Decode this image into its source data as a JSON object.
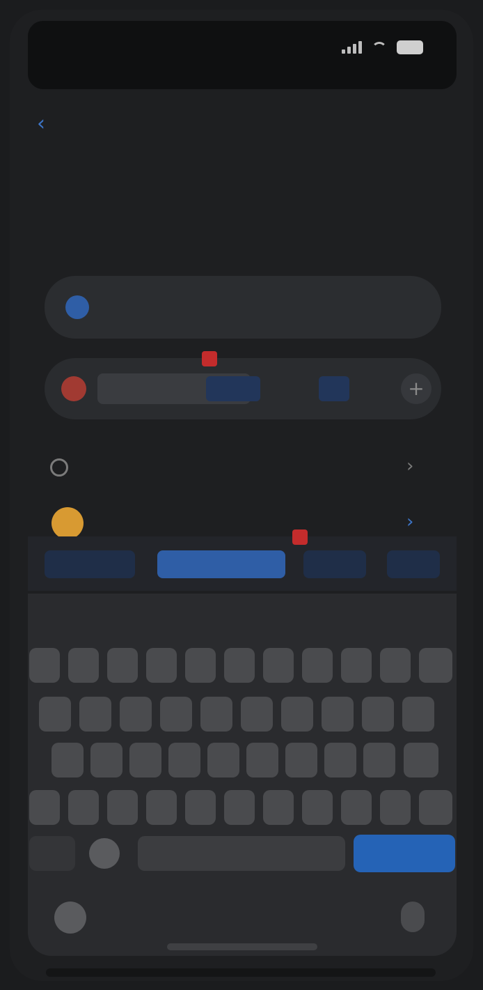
{
  "status_bar": {
    "time": "",
    "signal": "signal-bars-icon",
    "wifi": "wifi-icon",
    "battery": "battery-icon"
  },
  "nav": {
    "back_icon": "chevron-left-icon",
    "action_label": ""
  },
  "title": {
    "line1": "",
    "line2": ""
  },
  "card1": {
    "icon": "circle-icon",
    "text": ""
  },
  "card2": {
    "icon": "flag-icon",
    "selected_text": "",
    "chips": [
      "",
      "",
      ""
    ],
    "add_icon": "plus-icon"
  },
  "row3": {
    "icon": "circle-outline-icon",
    "text": "",
    "chevron": "chevron-right-icon"
  },
  "row4": {
    "avatar": "avatar",
    "text": "",
    "chevron": "chevron-right-icon"
  },
  "tag_bar": {
    "tags": [
      "",
      "",
      "",
      ""
    ],
    "active_index": 1
  },
  "keyboard": {
    "suggestions": [
      "",
      "",
      "",
      "",
      "",
      "",
      "",
      ""
    ],
    "row1": [
      "",
      "",
      "",
      "",
      "",
      "",
      "",
      "",
      "",
      "",
      ""
    ],
    "row2": [
      "",
      "",
      "",
      "",
      "",
      "",
      "",
      "",
      "",
      ""
    ],
    "row3": [
      "",
      "",
      "",
      "",
      "",
      "",
      "",
      "",
      "",
      ""
    ],
    "row4": [
      "",
      "",
      "",
      "",
      "",
      "",
      "",
      "",
      "",
      "",
      ""
    ],
    "mode_key": "",
    "space_key": "",
    "enter_key": ""
  },
  "colors": {
    "accent": "#2563b6",
    "badge": "#c42c2c",
    "background": "#1b1c1e"
  }
}
